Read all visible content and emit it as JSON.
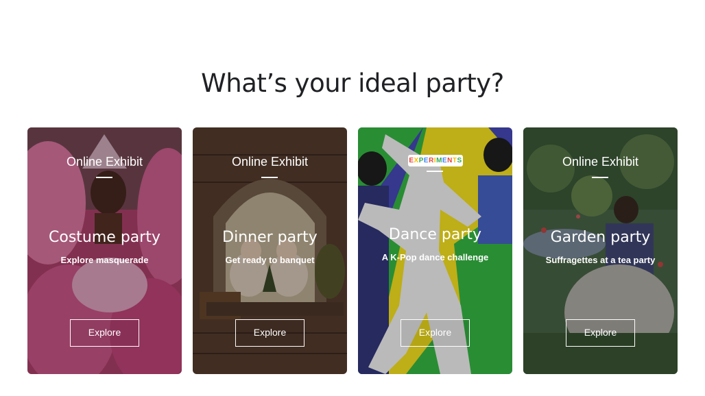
{
  "page": {
    "heading": "What’s your ideal party?"
  },
  "colors": {
    "heading": "#202124",
    "card_text": "#ffffff"
  },
  "cards": [
    {
      "eyebrow": "Online Exhibit",
      "title": "Costume party",
      "subtitle": "Explore masquerade",
      "button": "Explore",
      "image": "carnival-dancer-pink-feathers"
    },
    {
      "eyebrow": "Online Exhibit",
      "title": "Dinner party",
      "subtitle": "Get ready to banquet",
      "button": "Explore",
      "image": "painting-children-at-table"
    },
    {
      "eyebrow": "EXPERIMENTS",
      "title": "Dance party",
      "subtitle": "A K-Pop dance challenge",
      "button": "Explore",
      "image": "kpop-dancers-silhouette"
    },
    {
      "eyebrow": "Online Exhibit",
      "title": "Garden party",
      "subtitle": "Suffragettes at a tea party",
      "button": "Explore",
      "image": "painting-garden-tea"
    }
  ]
}
